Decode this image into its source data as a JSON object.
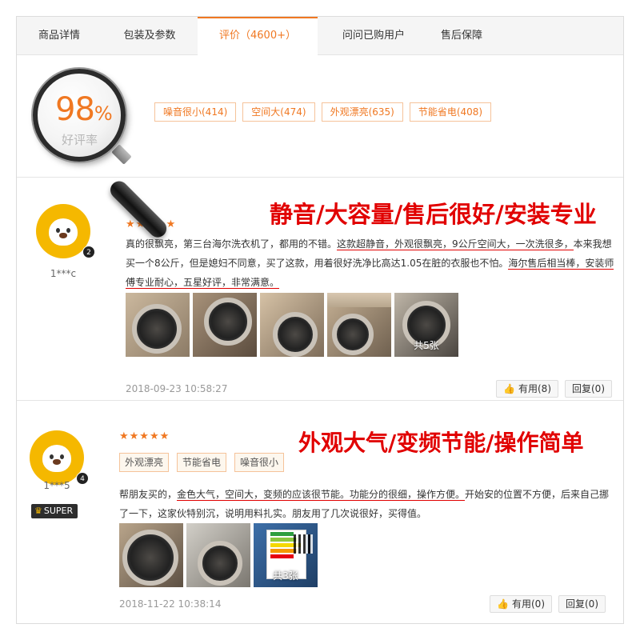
{
  "tabs": [
    {
      "label": "商品详情"
    },
    {
      "label": "包装及参数"
    },
    {
      "label": "评价（4600+）"
    },
    {
      "label": "问问已购用户"
    },
    {
      "label": "售后保障"
    }
  ],
  "summary": {
    "rate_number": "98",
    "rate_percent": "%",
    "rate_label": "好评率",
    "tags": [
      "噪音很小(414)",
      "空间大(474)",
      "外观漂亮(635)",
      "节能省电(408)"
    ]
  },
  "reviews": [
    {
      "username": "1***c",
      "level": "2",
      "stars": "★★★★★",
      "headline": "静音/大容量/售后很好/安装专业",
      "text_segments": [
        "真的很飘亮，第三台海尔洗衣机了，都用的不错。",
        "这款超静音，外观很飘亮，9公斤空间大，一次洗很多，",
        "本来我想买一个8公斤，但是媳妇不同意，买了这款，用着很好洗净比高达1.05在脏的衣服也不怕。",
        "海尔售后相当棒，安装师傅专业耐心，五星好评，非常满意。"
      ],
      "photo_count_label": "共5张",
      "date": "2018-09-23 10:58:27",
      "useful_label": "有用(8)",
      "reply_label": "回复(0)"
    },
    {
      "username": "1***5",
      "level": "4",
      "badge": "SUPER",
      "stars": "★★★★★",
      "headline": "外观大气/变频节能/操作简单",
      "tags": [
        "外观漂亮",
        "节能省电",
        "噪音很小"
      ],
      "text_segments": [
        "帮朋友买的，",
        "金色大气，空间大，变频的应该很节能。功能分的很细，操作方便。",
        "开始安的位置不方便，后来自己挪了一下，这家伙特别沉，说明用料扎实。朋友用了几次说很好，买得值。"
      ],
      "photo_count_label": "共3张",
      "date": "2018-11-22 10:38:14",
      "useful_label": "有用(0)",
      "reply_label": "回复(0)"
    }
  ],
  "colors": {
    "accent": "#f07822",
    "headline_red": "#e10000",
    "avatar_yellow": "#f5b800"
  },
  "icons": [
    "magnifier-icon",
    "star-icon",
    "thumb-up-icon",
    "crown-icon"
  ]
}
